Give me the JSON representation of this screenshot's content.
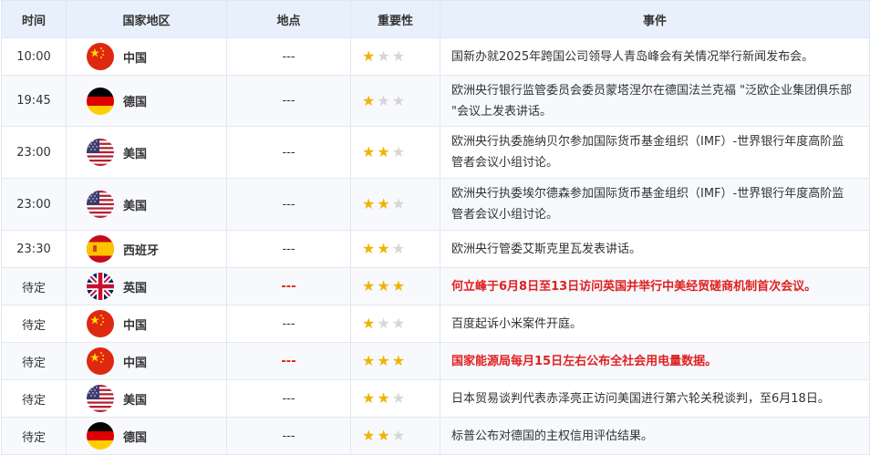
{
  "headers": {
    "time": "时间",
    "country": "国家地区",
    "place": "地点",
    "importance": "重要性",
    "event": "事件"
  },
  "rows": [
    {
      "time": "10:00",
      "flag": "cn",
      "country": "中国",
      "place": "---",
      "stars": 1,
      "highlight": false,
      "event": "国新办就2025年跨国公司领导人青岛峰会有关情况举行新闻发布会。"
    },
    {
      "time": "19:45",
      "flag": "de",
      "country": "德国",
      "place": "---",
      "stars": 1,
      "highlight": false,
      "event": "欧洲央行银行监管委员会委员蒙塔涅尔在德国法兰克福 \"泛欧企业集团俱乐部 \"会议上发表讲话。"
    },
    {
      "time": "23:00",
      "flag": "us",
      "country": "美国",
      "place": "---",
      "stars": 2,
      "highlight": false,
      "event": "欧洲央行执委施纳贝尔参加国际货币基金组织（IMF）-世界银行年度高阶监管者会议小组讨论。"
    },
    {
      "time": "23:00",
      "flag": "us",
      "country": "美国",
      "place": "---",
      "stars": 2,
      "highlight": false,
      "event": "欧洲央行执委埃尔德森参加国际货币基金组织（IMF）-世界银行年度高阶监管者会议小组讨论。"
    },
    {
      "time": "23:30",
      "flag": "es",
      "country": "西班牙",
      "place": "---",
      "stars": 2,
      "highlight": false,
      "event": "欧洲央行管委艾斯克里瓦发表讲话。"
    },
    {
      "time": "待定",
      "flag": "gb",
      "country": "英国",
      "place": "---",
      "stars": 3,
      "highlight": true,
      "event": "何立峰于6月8日至13日访问英国并举行中美经贸磋商机制首次会议。"
    },
    {
      "time": "待定",
      "flag": "cn",
      "country": "中国",
      "place": "---",
      "stars": 1,
      "highlight": false,
      "event": "百度起诉小米案件开庭。"
    },
    {
      "time": "待定",
      "flag": "cn",
      "country": "中国",
      "place": "---",
      "stars": 3,
      "highlight": true,
      "event": "国家能源局每月15日左右公布全社会用电量数据。"
    },
    {
      "time": "待定",
      "flag": "us",
      "country": "美国",
      "place": "---",
      "stars": 2,
      "highlight": false,
      "event": "日本贸易谈判代表赤泽亮正访问美国进行第六轮关税谈判，至6月18日。"
    },
    {
      "time": "待定",
      "flag": "de",
      "country": "德国",
      "place": "---",
      "stars": 2,
      "highlight": false,
      "event": "标普公布对德国的主权信用评估结果。"
    }
  ],
  "colors": {
    "header_bg": "#e8f1fb",
    "star_on": "#f0b400",
    "star_off": "#d6d6d6",
    "highlight": "#e02020"
  }
}
